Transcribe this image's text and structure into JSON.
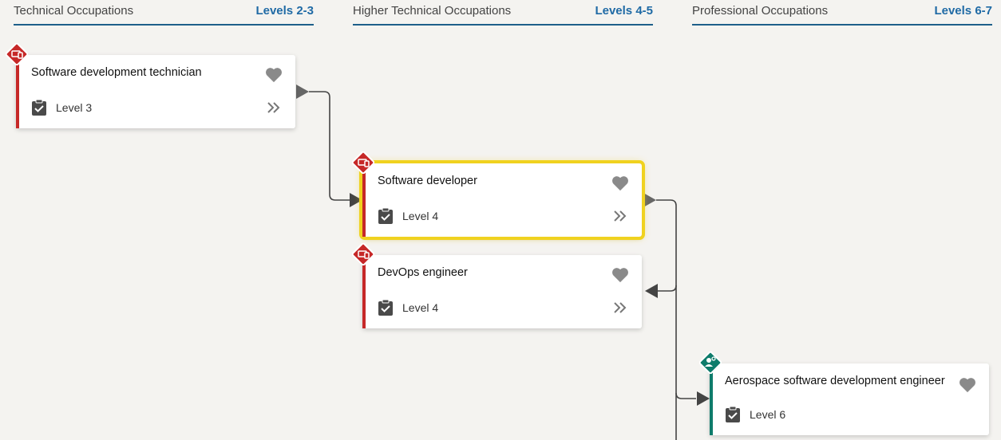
{
  "columns": [
    {
      "title": "Technical Occupations",
      "levels": "Levels 2-3"
    },
    {
      "title": "Higher Technical Occupations",
      "levels": "Levels 4-5"
    },
    {
      "title": "Professional Occupations",
      "levels": "Levels 6-7"
    }
  ],
  "cards": [
    {
      "title": "Software development technician",
      "level": "Level 3",
      "badge_icon": "digital-device-icon",
      "accent": "#c62828"
    },
    {
      "title": "Software developer",
      "level": "Level 4",
      "badge_icon": "digital-device-icon",
      "accent": "#c62828",
      "selected": true
    },
    {
      "title": "DevOps engineer",
      "level": "Level 4",
      "badge_icon": "digital-device-icon",
      "accent": "#c62828"
    },
    {
      "title": "Aerospace software development engineer",
      "level": "Level 6",
      "badge_icon": "engineering-person-icon",
      "accent": "#0e7c6b"
    }
  ],
  "colors": {
    "header_rule": "#1d5f8a",
    "levels_text": "#1f6aa5",
    "highlight": "#f0d21f",
    "digital_route": "#c62828",
    "engineering_route": "#0e7c6b"
  }
}
